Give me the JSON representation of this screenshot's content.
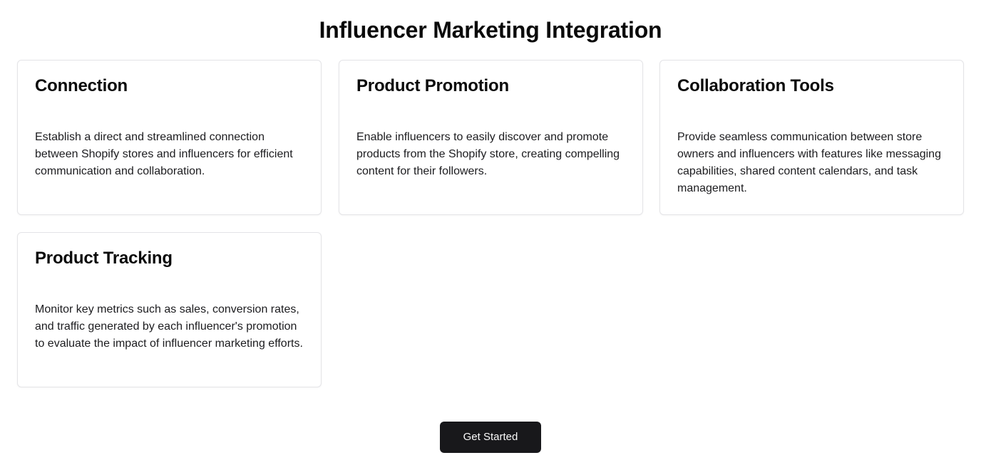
{
  "header": {
    "title": "Influencer Marketing Integration"
  },
  "cards": [
    {
      "title": "Connection",
      "description": "Establish a direct and streamlined connection between Shopify stores and influencers for efficient communication and collaboration."
    },
    {
      "title": "Product Promotion",
      "description": "Enable influencers to easily discover and promote products from the Shopify store, creating compelling content for their followers."
    },
    {
      "title": "Collaboration Tools",
      "description": "Provide seamless communication between store owners and influencers with features like messaging capabilities, shared content calendars, and task management."
    },
    {
      "title": "Product Tracking",
      "description": "Monitor key metrics such as sales, conversion rates, and traffic generated by each influencer's promotion to evaluate the impact of influencer marketing efforts."
    }
  ],
  "cta": {
    "label": "Get Started"
  },
  "colors": {
    "button_bg": "#18181b",
    "button_text": "#fafafa",
    "card_border": "#e4e4e7",
    "text": "#0a0a0a"
  }
}
